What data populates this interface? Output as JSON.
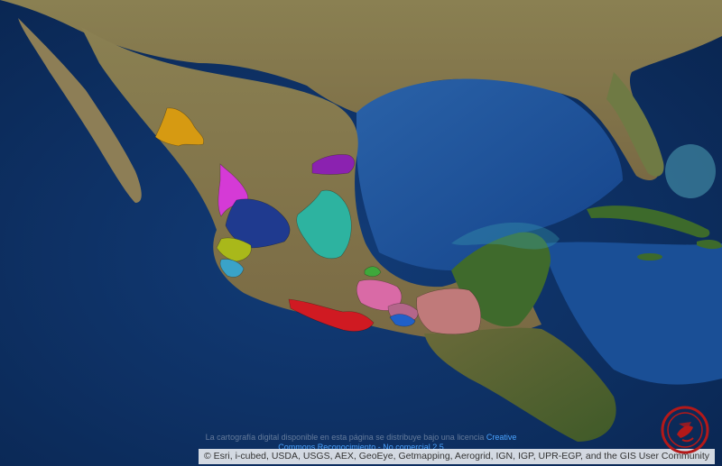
{
  "license": {
    "text_line1": "La cartografía digital disponible en esta página se distribuye bajo una licencia",
    "link_part1": "Creative",
    "link_part2": "Commons Reconocimiento - No comercial 2.5"
  },
  "attribution": "© Esri, i-cubed, USDA, USGS, AEX, GeoEye, Getmapping, Aerogrid, IGN, IGP, UPR-EGP, and the GIS User Community",
  "basemap": "satellite-imagery",
  "regions": [
    {
      "color": "#d69a12"
    },
    {
      "color": "#d53ad6"
    },
    {
      "color": "#1f3a8f"
    },
    {
      "color": "#a9b81a"
    },
    {
      "color": "#3aa3c8"
    },
    {
      "color": "#8b22b0"
    },
    {
      "color": "#2db3a0"
    },
    {
      "color": "#3ea83b"
    },
    {
      "color": "#d96aa6"
    },
    {
      "color": "#d01a22"
    },
    {
      "color": "#b4668a"
    },
    {
      "color": "#2060c8"
    },
    {
      "color": "#c07a7a"
    }
  ],
  "seal": {
    "name": "institutional-seal",
    "color": "#b41919"
  }
}
